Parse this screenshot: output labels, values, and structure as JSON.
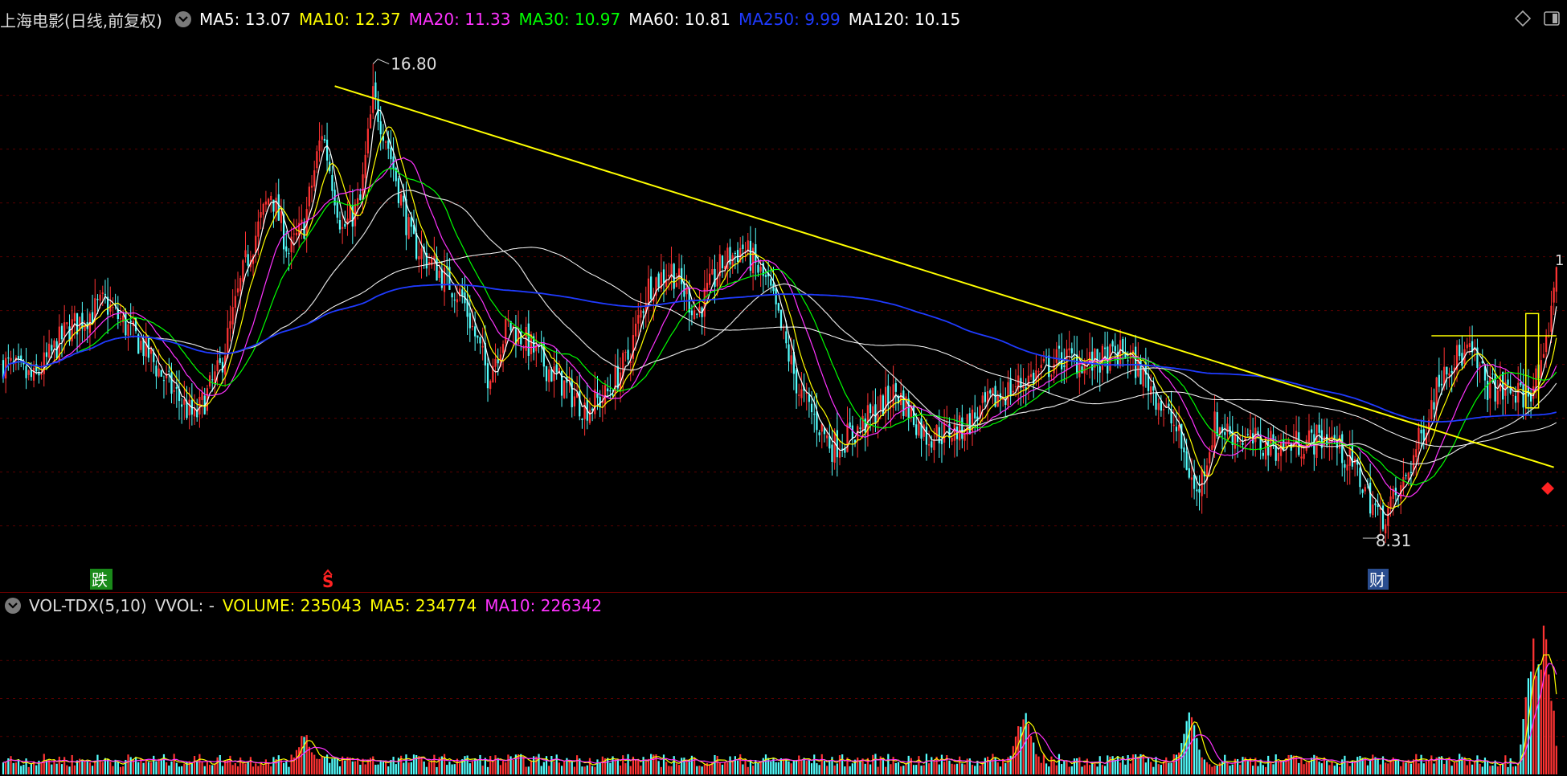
{
  "price_panel": {
    "title": "上海电影(日线,前复权)",
    "ma_labels": [
      {
        "text": "MA5: 13.07",
        "color": "#ffffff"
      },
      {
        "text": "MA10: 12.37",
        "color": "#ffff00"
      },
      {
        "text": "MA20: 11.33",
        "color": "#ff33ff"
      },
      {
        "text": "MA30: 10.97",
        "color": "#00ff00"
      },
      {
        "text": "MA60: 10.81",
        "color": "#ffffff"
      },
      {
        "text": "MA250: 9.99",
        "color": "#1f3bff"
      },
      {
        "text": "MA120: 10.15",
        "color": "#ffffff"
      }
    ],
    "high_label": "16.80",
    "low_label": "8.31",
    "marker_die": "跌",
    "marker_s": "S",
    "marker_cai": "财",
    "right_tick": "1"
  },
  "volume_panel": {
    "indicator": "VOL-TDX(5,10)",
    "vvol": "VVOL: -",
    "volume": "VOLUME: 235043",
    "ma5": "MA5: 234774",
    "ma10": "MA10: 226342"
  },
  "colors": {
    "up": "#ff3333",
    "down": "#54ffff",
    "trendline": "#ffff00",
    "grid": "#5a0000"
  },
  "chart_data": {
    "type": "candlestick",
    "title": "上海电影(日线,前复权)",
    "ylim": [
      7.6,
      17.3
    ],
    "annotations": [
      {
        "text": "16.80",
        "kind": "high",
        "value": 16.8
      },
      {
        "text": "8.31",
        "kind": "low",
        "value": 8.31
      }
    ],
    "moving_averages": [
      {
        "name": "MA5",
        "last": 13.07
      },
      {
        "name": "MA10",
        "last": 12.37
      },
      {
        "name": "MA20",
        "last": 11.33
      },
      {
        "name": "MA30",
        "last": 10.97
      },
      {
        "name": "MA60",
        "last": 10.81
      },
      {
        "name": "MA250",
        "last": 9.99
      },
      {
        "name": "MA120",
        "last": 10.15
      }
    ],
    "price_path": [
      [
        0,
        11.4
      ],
      [
        12,
        11.1
      ],
      [
        25,
        12.0
      ],
      [
        40,
        12.5
      ],
      [
        55,
        11.7
      ],
      [
        65,
        11.0
      ],
      [
        75,
        10.4
      ],
      [
        85,
        11.3
      ],
      [
        95,
        13.2
      ],
      [
        105,
        14.5
      ],
      [
        112,
        13.4
      ],
      [
        118,
        13.9
      ],
      [
        125,
        15.6
      ],
      [
        133,
        13.8
      ],
      [
        140,
        14.3
      ],
      [
        145,
        16.2
      ],
      [
        150,
        15.5
      ],
      [
        160,
        13.6
      ],
      [
        170,
        13.1
      ],
      [
        180,
        12.6
      ],
      [
        190,
        11.2
      ],
      [
        198,
        12.1
      ],
      [
        205,
        11.8
      ],
      [
        212,
        11.4
      ],
      [
        220,
        11.0
      ],
      [
        228,
        10.6
      ],
      [
        236,
        10.8
      ],
      [
        245,
        11.5
      ],
      [
        253,
        12.8
      ],
      [
        262,
        13.1
      ],
      [
        272,
        12.3
      ],
      [
        282,
        13.2
      ],
      [
        290,
        13.5
      ],
      [
        300,
        12.8
      ],
      [
        312,
        10.9
      ],
      [
        325,
        9.9
      ],
      [
        335,
        10.2
      ],
      [
        350,
        10.9
      ],
      [
        362,
        10.1
      ],
      [
        375,
        10.2
      ],
      [
        390,
        10.8
      ],
      [
        405,
        11.2
      ],
      [
        415,
        11.5
      ],
      [
        428,
        11.4
      ],
      [
        440,
        11.6
      ],
      [
        450,
        11.0
      ],
      [
        460,
        10.2
      ],
      [
        468,
        9.0
      ],
      [
        475,
        10.3
      ],
      [
        488,
        10.0
      ],
      [
        500,
        9.9
      ],
      [
        512,
        10.0
      ],
      [
        520,
        10.1
      ],
      [
        530,
        9.5
      ],
      [
        540,
        8.6
      ],
      [
        548,
        9.1
      ],
      [
        556,
        10.1
      ],
      [
        565,
        11.4
      ],
      [
        575,
        11.6
      ],
      [
        582,
        11.0
      ],
      [
        590,
        10.9
      ],
      [
        596,
        10.8
      ],
      [
        604,
        11.3
      ],
      [
        608,
        12.9
      ]
    ],
    "trendline": {
      "from": {
        "bar": 130,
        "price": 16.4
      },
      "to": {
        "bar": 608,
        "price": 9.53
      }
    },
    "volume": {
      "last": 235043,
      "ma5": 234774,
      "ma10": 226342,
      "ylim": [
        0,
        1250000
      ],
      "spikes": [
        {
          "bar": 118,
          "value": 380000
        },
        {
          "bar": 400,
          "value": 560000
        },
        {
          "bar": 465,
          "value": 520000
        },
        {
          "bar": 600,
          "value": 1050000
        },
        {
          "bar": 604,
          "value": 1230000
        }
      ]
    }
  }
}
